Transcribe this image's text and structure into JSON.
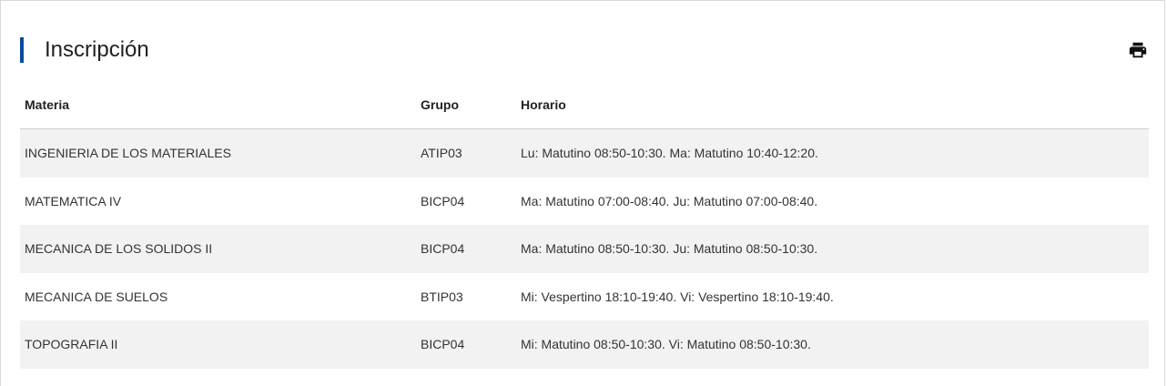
{
  "header": {
    "title": "Inscripción",
    "accent_color": "#0b4a9c",
    "print_icon": "printer-icon"
  },
  "table": {
    "columns": [
      "Materia",
      "Grupo",
      "Horario"
    ],
    "rows": [
      {
        "materia": "INGENIERIA DE LOS MATERIALES",
        "grupo": "ATIP03",
        "horario": "Lu: Matutino 08:50-10:30. Ma: Matutino 10:40-12:20."
      },
      {
        "materia": "MATEMATICA IV",
        "grupo": "BICP04",
        "horario": "Ma: Matutino 07:00-08:40. Ju: Matutino 07:00-08:40."
      },
      {
        "materia": "MECANICA DE LOS SOLIDOS II",
        "grupo": "BICP04",
        "horario": "Ma: Matutino 08:50-10:30. Ju: Matutino 08:50-10:30."
      },
      {
        "materia": "MECANICA DE SUELOS",
        "grupo": "BTIP03",
        "horario": "Mi: Vespertino 18:10-19:40. Vi: Vespertino 18:10-19:40."
      },
      {
        "materia": "TOPOGRAFIA II",
        "grupo": "BICP04",
        "horario": "Mi: Matutino 08:50-10:30. Vi: Matutino 08:50-10:30."
      }
    ],
    "stripe_color": "#f2f2f2"
  }
}
